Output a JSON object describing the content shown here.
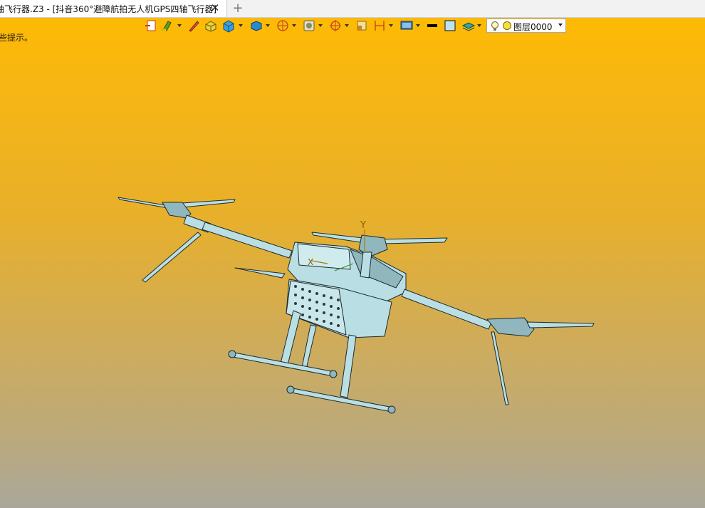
{
  "window": {
    "tab_title": "轴飞行器.Z3 - [抖音360°避障航拍无人机GPS四轴飞行器]",
    "close_glyph": "✕",
    "new_tab_glyph": "+"
  },
  "hint": {
    "text": "些提示。"
  },
  "toolbar": {
    "icons": [
      "insert-file-icon",
      "paint-brush-icon",
      "pen-icon",
      "box-face-icon",
      "solid-box-icon",
      "view-cube-icon",
      "sphere-wire-icon",
      "frame-icon",
      "target-icon",
      "clip-icon",
      "dimension-icon",
      "display-mode-icon",
      "line-color-icon",
      "fill-color-icon",
      "layer-stack-icon"
    ]
  },
  "layer": {
    "name": "图层0000"
  },
  "viewport": {
    "axis_y_label": "Y",
    "axis_x_label": "X",
    "model_color": "#b9dfe4",
    "edge_color": "#1c2a2e",
    "background_top": "#ffbb00",
    "background_bottom": "#aaa79a"
  }
}
